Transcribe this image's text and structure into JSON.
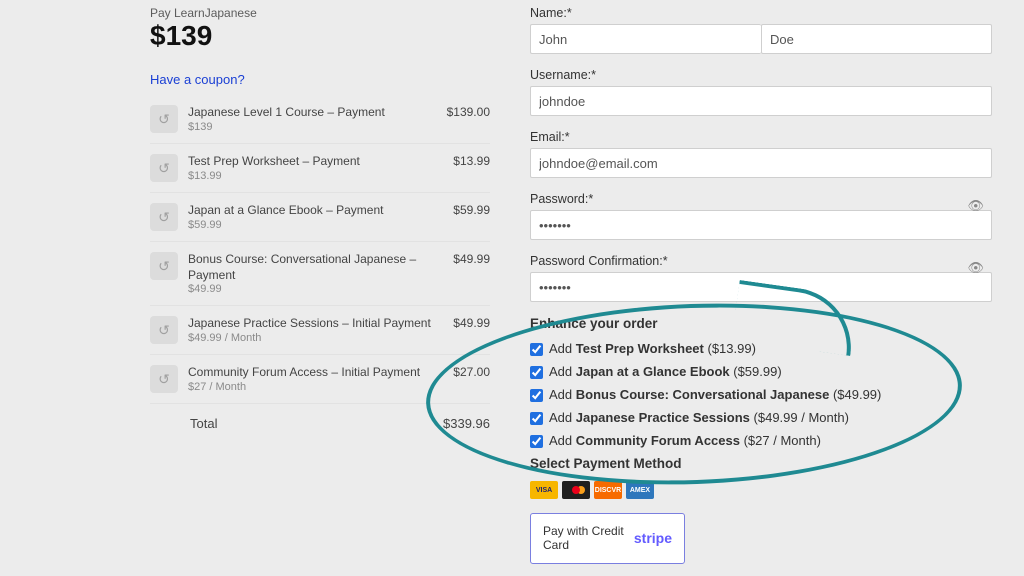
{
  "header": {
    "pay_to": "Pay LearnJapanese",
    "price": "$139"
  },
  "coupon": {
    "text": "Have a coupon?"
  },
  "lines": [
    {
      "title": "Japanese Level 1 Course – Payment",
      "sub": "$139",
      "price": "$139.00"
    },
    {
      "title": "Test Prep Worksheet – Payment",
      "sub": "$13.99",
      "price": "$13.99"
    },
    {
      "title": "Japan at a Glance Ebook – Payment",
      "sub": "$59.99",
      "price": "$59.99"
    },
    {
      "title": "Bonus Course: Conversational Japanese – Payment",
      "sub": "$49.99",
      "price": "$49.99"
    },
    {
      "title": "Japanese Practice Sessions – Initial Payment",
      "sub": "$49.99 / Month",
      "price": "$49.99"
    },
    {
      "title": "Community Forum Access – Initial Payment",
      "sub": "$27 / Month",
      "price": "$27.00"
    }
  ],
  "total": {
    "label": "Total",
    "amount": "$339.96"
  },
  "form": {
    "name_label": "Name:*",
    "first_name": "John",
    "last_name": "Doe",
    "username_label": "Username:*",
    "username": "johndoe",
    "email_label": "Email:*",
    "email": "johndoe@email.com",
    "password_label": "Password:*",
    "password": "•••••••",
    "password_conf_label": "Password Confirmation:*",
    "password_conf": "•••••••"
  },
  "enhance": {
    "title": "Enhance your order",
    "items": [
      {
        "prefix": "Add ",
        "name": "Test Prep Worksheet",
        "price": " ($13.99)"
      },
      {
        "prefix": "Add ",
        "name": "Japan at a Glance Ebook",
        "price": " ($59.99)"
      },
      {
        "prefix": "Add ",
        "name": "Bonus Course: Conversational Japanese",
        "price": " ($49.99)"
      },
      {
        "prefix": "Add ",
        "name": "Japanese Practice Sessions",
        "price": " ($49.99 / Month)"
      },
      {
        "prefix": "Add ",
        "name": "Community Forum Access",
        "price": " ($27 / Month)"
      }
    ]
  },
  "payment": {
    "select_title": "Select Payment Method",
    "card_labels": {
      "visa": "VISA",
      "disc": "DISCVR",
      "amex": "AMEX"
    },
    "btn_label": "Pay with Credit Card",
    "stripe": "stripe"
  }
}
